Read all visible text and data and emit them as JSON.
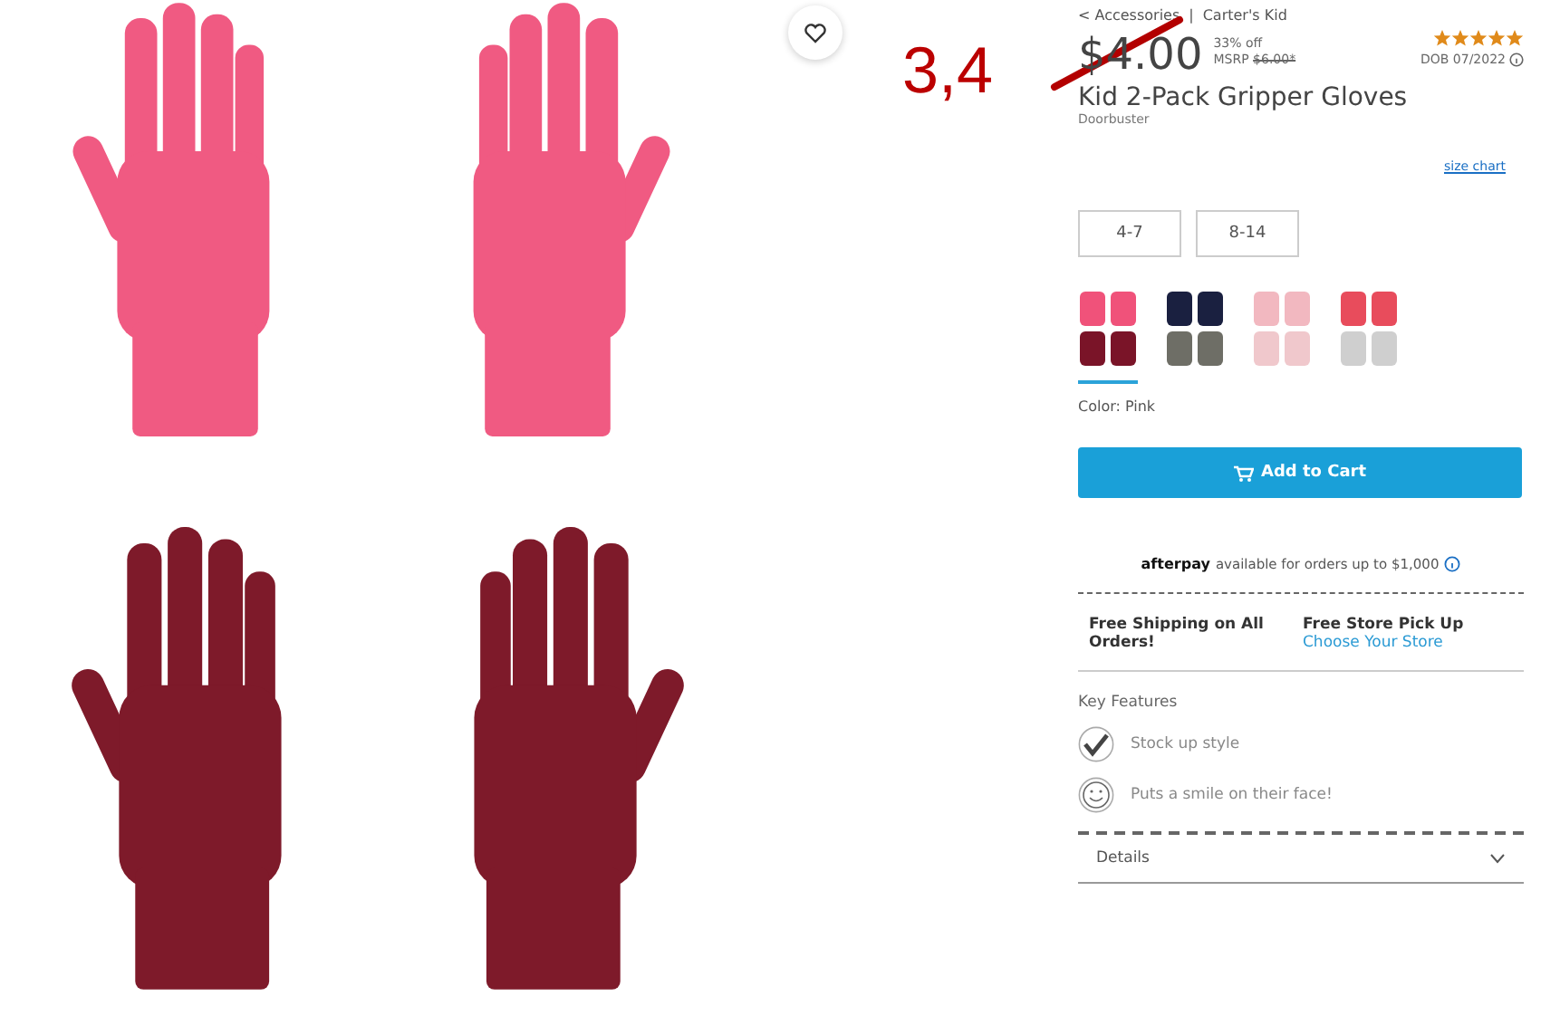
{
  "annotation": {
    "text": "3,4"
  },
  "breadcrumb": [
    "< Accessories",
    "Carter's Kid"
  ],
  "breadcrumb_separator": "|",
  "price": {
    "current": "$4.00",
    "discount": "33% off",
    "msrp_label": "MSRP",
    "msrp": "$6.00*",
    "struck_out": true
  },
  "rating": {
    "stars": 5,
    "date": "DOB 07/2022"
  },
  "product": {
    "title": "Kid 2-Pack Gripper Gloves",
    "badge": "Doorbuster"
  },
  "size_chart": "size chart",
  "sizes": [
    {
      "label": "4-7",
      "selected": false
    },
    {
      "label": "8-14",
      "selected": false
    }
  ],
  "swatches": [
    {
      "selected": true
    },
    {
      "selected": false
    },
    {
      "selected": false
    },
    {
      "selected": false
    }
  ],
  "color_label": "Color: Pink",
  "add_to_cart": "Add to Cart",
  "afterpay": {
    "brand": "afterpay",
    "text": "available for orders up to $1,000"
  },
  "shipping": {
    "free_shipping": "Free Shipping on All Orders!",
    "pickup_title": "Free Store Pick Up",
    "pickup_link": "Choose Your Store"
  },
  "key_features": {
    "title": "Key Features",
    "items": [
      {
        "kind": "check",
        "text": "Stock up style"
      },
      {
        "kind": "smile",
        "text": "Puts a smile on their face!"
      }
    ]
  },
  "details": {
    "label": "Details",
    "expanded": false
  }
}
